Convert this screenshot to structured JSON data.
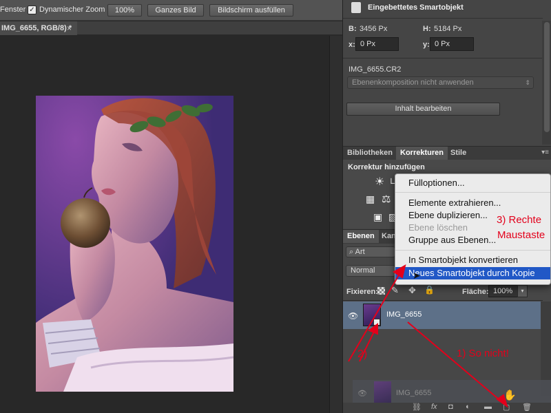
{
  "options_bar": {
    "window_label": "Fenster",
    "zoom_checkbox_label": "Dynamischer Zoom",
    "buttons": [
      "100%",
      "Ganzes Bild",
      "Bildschirm ausfüllen"
    ]
  },
  "document": {
    "tab_title": "IMG_6655, RGB/8) *"
  },
  "properties": {
    "title": "Eingebettetes Smartobjekt",
    "b_label": "B:",
    "b_value": "3456 Px",
    "h_label": "H:",
    "h_value": "5184 Px",
    "x_label": "x:",
    "x_value": "0 Px",
    "y_label": "y:",
    "y_value": "0 Px",
    "filename": "IMG_6655.CR2",
    "layer_comp": "Ebenenkomposition nicht anwenden",
    "edit_button": "Inhalt bearbeiten"
  },
  "adjustments": {
    "tabs": [
      "Bibliotheken",
      "Korrekturen",
      "Stile"
    ],
    "active_tab": "Korrekturen",
    "heading": "Korrektur hinzufügen"
  },
  "layers": {
    "tabs": [
      "Ebenen",
      "Kan"
    ],
    "search_kind": "Art",
    "blend_mode": "Normal",
    "lock_label": "Fixieren:",
    "fill_label": "Fläche:",
    "fill_value": "100%",
    "layer_name": "IMG_6655",
    "dragged_layer_name": "IMG_6655"
  },
  "context_menu": {
    "items": [
      {
        "label": "Fülloptionen...",
        "enabled": true
      },
      {
        "label": "Elemente extrahieren...",
        "enabled": true
      },
      {
        "label": "Ebene duplizieren...",
        "enabled": true
      },
      {
        "label": "Ebene löschen",
        "enabled": false
      },
      {
        "label": "Gruppe aus Ebenen...",
        "enabled": true
      },
      {
        "label": "In Smartobjekt konvertieren",
        "enabled": true
      },
      {
        "label": "Neues Smartobjekt durch Kopie",
        "enabled": true,
        "highlighted": true
      }
    ]
  },
  "annotations": {
    "step1": "1) So nicht!",
    "step2": "2)",
    "step3_line1": "3) Rechte",
    "step3_line2": "Maustaste",
    "color": "#e3001b"
  },
  "colors": {
    "highlight": "#2158c6",
    "selected_layer": "#5d7088",
    "panel": "#454545"
  }
}
